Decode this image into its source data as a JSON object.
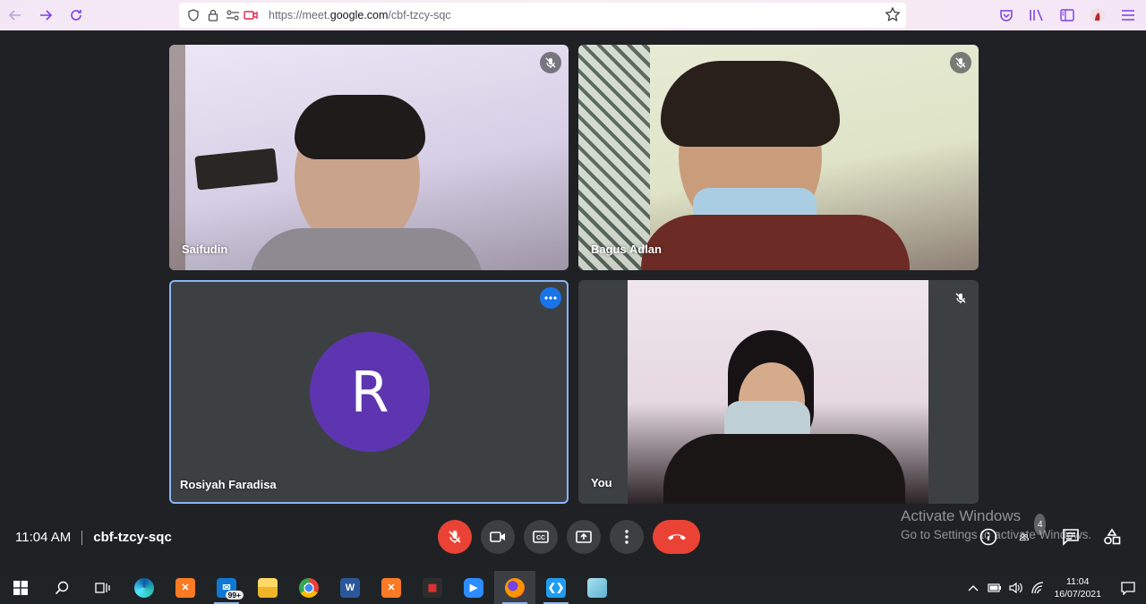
{
  "browser": {
    "url_prefix": "https://meet.",
    "url_domain": "google.com",
    "url_path": "/cbf-tzcy-sqc"
  },
  "participants": [
    {
      "name": "Saifudin",
      "muted": true,
      "video": true
    },
    {
      "name": "Bagus Adlan",
      "muted": true,
      "video": true
    },
    {
      "name": "Rosiyah Faradisa",
      "muted": false,
      "video": false,
      "avatar_letter": "R",
      "avatar_color": "#5e35b1"
    },
    {
      "name": "You",
      "muted": true,
      "video": true
    }
  ],
  "meeting": {
    "time": "11:04 AM",
    "code": "cbf-tzcy-sqc",
    "participant_count": "4"
  },
  "watermark": {
    "line1": "Activate Windows",
    "line2": "Go to Settings to activate Windows."
  },
  "taskbar": {
    "mail_badge": "99+",
    "clock_time": "11:04",
    "clock_date": "16/07/2021"
  },
  "colors": {
    "accent": "#1a73e8",
    "end_call": "#ea4335",
    "highlight_border": "#8ab4f8",
    "browser_accent": "#7b3fe4"
  }
}
